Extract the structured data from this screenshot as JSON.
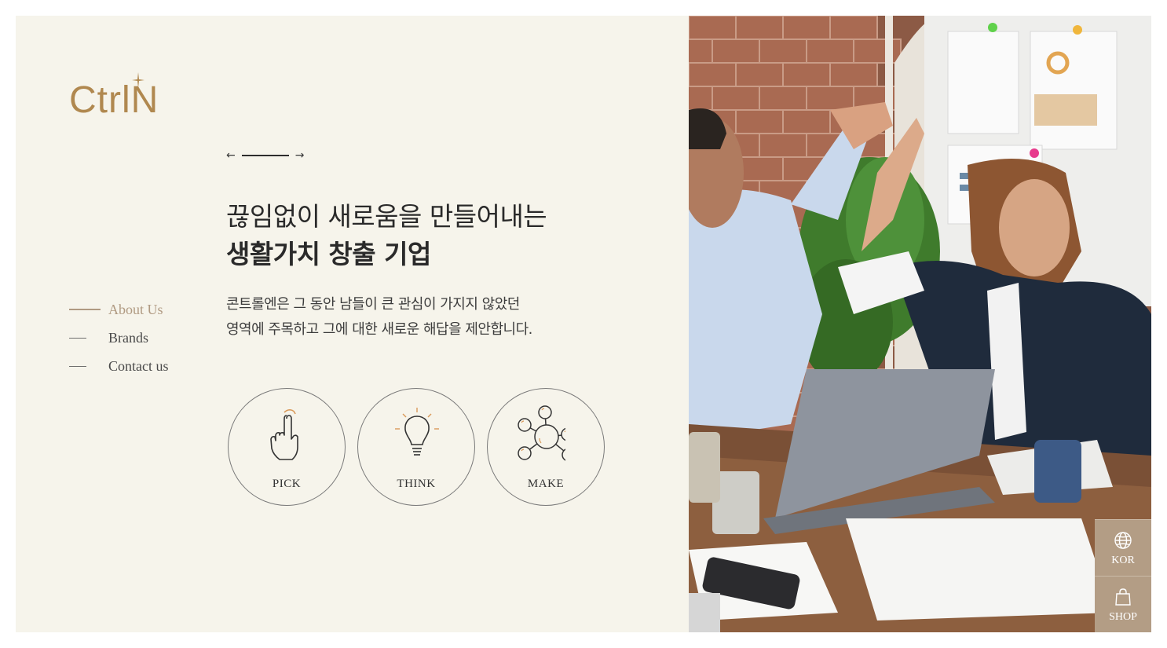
{
  "brand": {
    "logo_text": "CtrlN",
    "accent_color": "#b0884f"
  },
  "slider": {
    "prev_icon": "arrow-left-icon",
    "next_icon": "arrow-right-icon"
  },
  "hero": {
    "headline_line1": "끊임없이 새로움을 만들어내는",
    "headline_line2": "생활가치 창출 기업",
    "description_line1": "콘트롤엔은 그 동안 남들이 큰 관심이 가지지 않았던",
    "description_line2": "영역에 주목하고 그에 대한 새로운 해답을 제안합니다."
  },
  "nav": {
    "items": [
      {
        "label": "About Us",
        "active": true
      },
      {
        "label": "Brands",
        "active": false
      },
      {
        "label": "Contact us",
        "active": false
      }
    ]
  },
  "values": [
    {
      "label": "PICK",
      "icon": "pointing-hand-icon"
    },
    {
      "label": "THINK",
      "icon": "lightbulb-icon"
    },
    {
      "label": "MAKE",
      "icon": "network-nodes-icon"
    }
  ],
  "side_buttons": [
    {
      "label": "KOR",
      "icon": "globe-icon"
    },
    {
      "label": "SHOP",
      "icon": "shopping-bag-icon"
    }
  ],
  "colors": {
    "background": "#f6f4eb",
    "nav_active": "#b09a82",
    "side_button": "#b39d85"
  }
}
